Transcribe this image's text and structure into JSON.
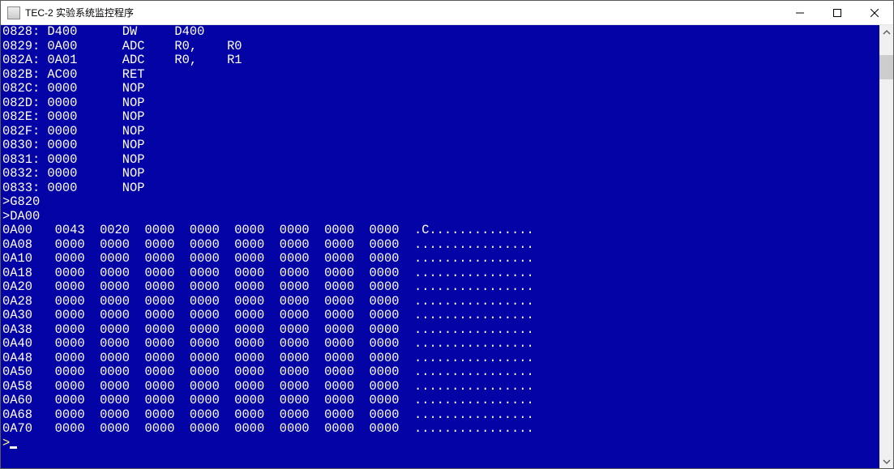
{
  "window": {
    "title": "TEC-2 实验系统监控程序"
  },
  "disasm": [
    {
      "addr": "0828",
      "hex": "D400",
      "mnem": "DW",
      "args": "D400"
    },
    {
      "addr": "0829",
      "hex": "0A00",
      "mnem": "ADC",
      "args": "R0,    R0"
    },
    {
      "addr": "082A",
      "hex": "0A01",
      "mnem": "ADC",
      "args": "R0,    R1"
    },
    {
      "addr": "082B",
      "hex": "AC00",
      "mnem": "RET",
      "args": ""
    },
    {
      "addr": "082C",
      "hex": "0000",
      "mnem": "NOP",
      "args": ""
    },
    {
      "addr": "082D",
      "hex": "0000",
      "mnem": "NOP",
      "args": ""
    },
    {
      "addr": "082E",
      "hex": "0000",
      "mnem": "NOP",
      "args": ""
    },
    {
      "addr": "082F",
      "hex": "0000",
      "mnem": "NOP",
      "args": ""
    },
    {
      "addr": "0830",
      "hex": "0000",
      "mnem": "NOP",
      "args": ""
    },
    {
      "addr": "0831",
      "hex": "0000",
      "mnem": "NOP",
      "args": ""
    },
    {
      "addr": "0832",
      "hex": "0000",
      "mnem": "NOP",
      "args": ""
    },
    {
      "addr": "0833",
      "hex": "0000",
      "mnem": "NOP",
      "args": ""
    }
  ],
  "commands": [
    ">G820",
    ">DA00"
  ],
  "dump": [
    {
      "addr": "0A00",
      "words": [
        "0043",
        "0020",
        "0000",
        "0000",
        "0000",
        "0000",
        "0000",
        "0000"
      ],
      "ascii": ".C.............."
    },
    {
      "addr": "0A08",
      "words": [
        "0000",
        "0000",
        "0000",
        "0000",
        "0000",
        "0000",
        "0000",
        "0000"
      ],
      "ascii": "................"
    },
    {
      "addr": "0A10",
      "words": [
        "0000",
        "0000",
        "0000",
        "0000",
        "0000",
        "0000",
        "0000",
        "0000"
      ],
      "ascii": "................"
    },
    {
      "addr": "0A18",
      "words": [
        "0000",
        "0000",
        "0000",
        "0000",
        "0000",
        "0000",
        "0000",
        "0000"
      ],
      "ascii": "................"
    },
    {
      "addr": "0A20",
      "words": [
        "0000",
        "0000",
        "0000",
        "0000",
        "0000",
        "0000",
        "0000",
        "0000"
      ],
      "ascii": "................"
    },
    {
      "addr": "0A28",
      "words": [
        "0000",
        "0000",
        "0000",
        "0000",
        "0000",
        "0000",
        "0000",
        "0000"
      ],
      "ascii": "................"
    },
    {
      "addr": "0A30",
      "words": [
        "0000",
        "0000",
        "0000",
        "0000",
        "0000",
        "0000",
        "0000",
        "0000"
      ],
      "ascii": "................"
    },
    {
      "addr": "0A38",
      "words": [
        "0000",
        "0000",
        "0000",
        "0000",
        "0000",
        "0000",
        "0000",
        "0000"
      ],
      "ascii": "................"
    },
    {
      "addr": "0A40",
      "words": [
        "0000",
        "0000",
        "0000",
        "0000",
        "0000",
        "0000",
        "0000",
        "0000"
      ],
      "ascii": "................"
    },
    {
      "addr": "0A48",
      "words": [
        "0000",
        "0000",
        "0000",
        "0000",
        "0000",
        "0000",
        "0000",
        "0000"
      ],
      "ascii": "................"
    },
    {
      "addr": "0A50",
      "words": [
        "0000",
        "0000",
        "0000",
        "0000",
        "0000",
        "0000",
        "0000",
        "0000"
      ],
      "ascii": "................"
    },
    {
      "addr": "0A58",
      "words": [
        "0000",
        "0000",
        "0000",
        "0000",
        "0000",
        "0000",
        "0000",
        "0000"
      ],
      "ascii": "................"
    },
    {
      "addr": "0A60",
      "words": [
        "0000",
        "0000",
        "0000",
        "0000",
        "0000",
        "0000",
        "0000",
        "0000"
      ],
      "ascii": "................"
    },
    {
      "addr": "0A68",
      "words": [
        "0000",
        "0000",
        "0000",
        "0000",
        "0000",
        "0000",
        "0000",
        "0000"
      ],
      "ascii": "................"
    },
    {
      "addr": "0A70",
      "words": [
        "0000",
        "0000",
        "0000",
        "0000",
        "0000",
        "0000",
        "0000",
        "0000"
      ],
      "ascii": "................"
    }
  ],
  "prompt": ">"
}
